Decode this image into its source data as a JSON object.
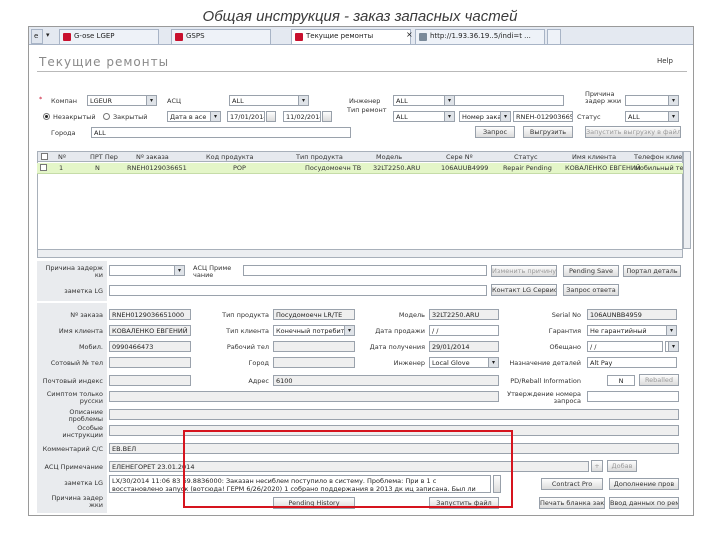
{
  "slide_title": "Общая инструкция - заказ запасных частей",
  "browser": {
    "tabs": [
      {
        "label": "G-ose LGEP"
      },
      {
        "label": "GSPS"
      },
      {
        "label": "Текущие ремонты"
      },
      {
        "label": "http://1.93.36.19..5/indi=t ..."
      }
    ],
    "tab_close": "×",
    "arrow": "▾"
  },
  "app": {
    "title": "Текущие ремонты",
    "help": "Help"
  },
  "filter": {
    "company_label": "Компан",
    "company_value": "LGEUR",
    "asc_label": "АСЦ",
    "asc_value": "ALL",
    "engineer_label": "Инженер",
    "engineer_value": "ALL",
    "delay_reason_label": "Причина задер жки",
    "delay_reason_value": "",
    "radio_unclosed": "Незакрытый",
    "radio_closed": "Закрытый",
    "date_mode": "Дата в асе",
    "date_from": "17/01/2014",
    "date_to": "11/02/2014",
    "repair_type_label": "Тип ремонт",
    "repair_type_value": "ALL",
    "search_by": "Номер заказ",
    "search_value": "RNEH-0129036651",
    "status_label": "Статус",
    "status_value": "ALL",
    "region_label": "Города",
    "region_value": "ALL",
    "btn_search": "Запрос",
    "btn_export": "Выгрузить",
    "btn_export_excel": "Запустить выгрузку в файл"
  },
  "grid": {
    "headers": [
      "Nº",
      "ПРТ Пер",
      "Nº заказа",
      "Код продукта",
      "Тип продукта",
      "Модель",
      "Сере Nº",
      "Статус",
      "Имя клиента",
      "Телефон клие"
    ],
    "rows": [
      [
        "1",
        "N",
        "RNEH0129036651",
        "POP",
        "Посудомоечн ТВ",
        "32LT2250.ARU",
        "106AUUB4999",
        "Repair Pending",
        "КОВАЛЕНКО ЕВГЕНИЙ",
        "мобильный тел"
      ]
    ]
  },
  "detail_top": {
    "delay_reason_label": "Причина задерж ки",
    "asc_note_label": "АСЦ Приме чание",
    "btn_save_reason": "Изменить причину",
    "btn_pending_save": "Pending Save",
    "btn_portal_detail": "Портал деталь",
    "remark_lg_label": "заметка LG",
    "btn_contact_lg": "Контакт LG Сервис",
    "btn_inquiry_answer": "Запрос ответа"
  },
  "detail": {
    "order_no_label": "Nº заказа",
    "order_no": "RNEH0129036651000",
    "product_type_label": "Тип продукта",
    "product_type": "Посудомоечн LR/TE",
    "model_label": "Модель",
    "model": "32LT2250.ARU",
    "serial_label": "Serial No",
    "serial": "106AUNBB4959",
    "client_label": "Имя клиента",
    "client": "КОВАЛЕНКО ЕВГЕНИЙ",
    "client_type_label": "Тип клиента",
    "client_type": "Конечный потребит",
    "sale_date_label": "Дата продажи",
    "sale_date": "/ /",
    "warranty_label": "Гарантия",
    "warranty": "Не гарантийный",
    "mobile_label": "Мобил.",
    "mobile": "0990466473",
    "work_phone_label": "Рабочий тел",
    "work_phone": "",
    "recv_date_label": "Дата получения",
    "recv_date": "29/01/2014",
    "promised_label": "Обещано",
    "promised": "/ /",
    "alt_phone_label": "Сотовый № тел",
    "alt_phone": "",
    "city_label": "Город",
    "city": "",
    "engineer_label": "Инженер",
    "engineer": "Local Glove",
    "assign_label": "Назначение деталей",
    "assign_value": "Alt Pay",
    "postcode_label": "Почтовый индекс",
    "postcode": "",
    "address_label": "Адрес",
    "address": "6100",
    "pd_label": "PD/Reball Information",
    "pd_value": "N",
    "btn_pd": "Reballed",
    "symptom_label": "Симптом только русски",
    "symptom": "",
    "confirm_label": "Утверждение номера запроса",
    "confirm": "",
    "problem_label": "Описание проблемы",
    "problem": "",
    "special_label": "Особые инструкции",
    "special": "",
    "comment_label": "Комментарий C/C",
    "comment": "ЕВ.ВЕЛ",
    "asc_note_label": "АСЦ Примечание",
    "asc_note": "ЕЛЕНЕГОРЕТ 23.01.2014",
    "lg_note_label": "заметка LG",
    "lg_note_text": "LX/30/2014 11:06 83 69.8836000: Заказан несиблем поступило в систему. Проблема: При в 1 с восстановлено запуск (вотсюда! ГЕРМ 6/26/2020) 1 собрано поддержания в 2013 дк иц записана. Был ли ткоан в заказке.",
    "btn_add": "+",
    "btn_add_note": "Добав",
    "delay_label2": "Причина задер жки",
    "btn_contract": "Contract Pro",
    "btn_attachment": "Дополнение пров",
    "btn_pending_history": "Pending History",
    "btn_export_file": "Запустить файл",
    "btn_print": "Печать бланка заказ",
    "btn_sale": "Ввод данных по ремо-тт"
  }
}
